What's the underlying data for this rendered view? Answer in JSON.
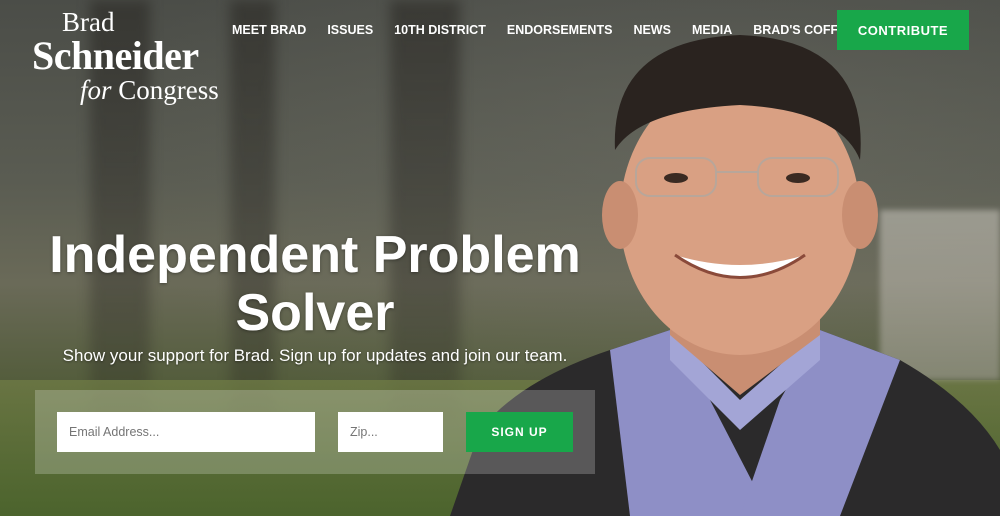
{
  "logo": {
    "line1": "Brad",
    "line2": "Schneider",
    "line3_italic": "for",
    "line3_rest": " Congress"
  },
  "nav": [
    "MEET BRAD",
    "ISSUES",
    "10TH DISTRICT",
    "ENDORSEMENTS",
    "NEWS",
    "MEDIA",
    "BRAD'S COFFEE CLUB"
  ],
  "contribute_label": "CONTRIBUTE",
  "hero": {
    "headline": "Independent Problem Solver",
    "subheadline": "Show your support for Brad. Sign up for updates and join our team."
  },
  "signup_form": {
    "email_placeholder": "Email Address...",
    "zip_placeholder": "Zip...",
    "button_label": "SIGN UP"
  },
  "colors": {
    "accent_green": "#18a74a"
  }
}
